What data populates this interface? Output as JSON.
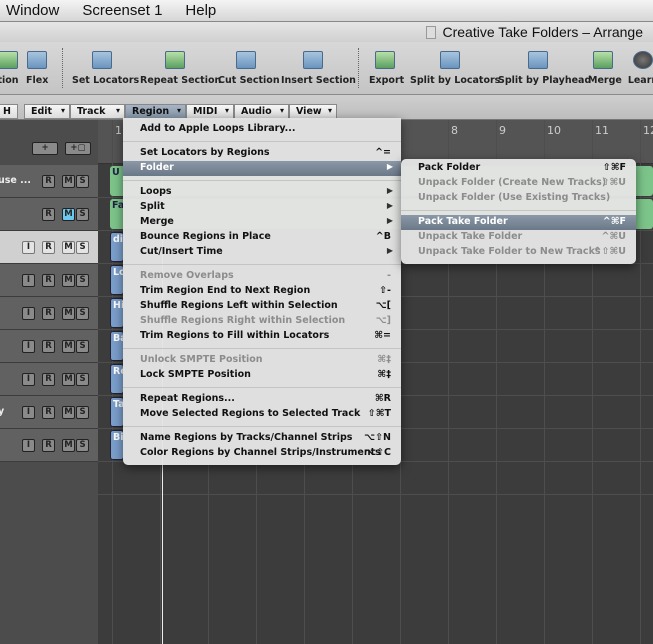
{
  "menubar": [
    "Window",
    "Screenset 1",
    "Help"
  ],
  "window_title": "Creative Take Folders – Arrange",
  "toolbar": {
    "items": [
      {
        "label": "tion",
        "icon": "automation-icon"
      },
      {
        "label": "Flex",
        "icon": "flex-icon"
      },
      {
        "label": "Set Locators",
        "icon": "set-locators-icon"
      },
      {
        "label": "Repeat Section",
        "icon": "repeat-section-icon"
      },
      {
        "label": "Cut Section",
        "icon": "cut-section-icon"
      },
      {
        "label": "Insert Section",
        "icon": "insert-section-icon"
      },
      {
        "label": "Export",
        "icon": "export-icon"
      },
      {
        "label": "Split by Locators",
        "icon": "split-locators-icon"
      },
      {
        "label": "Split by Playhead",
        "icon": "split-playhead-icon"
      },
      {
        "label": "Merge",
        "icon": "merge-icon"
      },
      {
        "label": "Learn",
        "icon": "learn-knob-icon"
      }
    ]
  },
  "local_menu": {
    "left_button": "H",
    "items": [
      "Edit",
      "Track",
      "Region",
      "MIDI",
      "Audio",
      "View"
    ],
    "active": "Region"
  },
  "track_header": {
    "add_label": "+",
    "add_folder_label": "+▢"
  },
  "tracks": [
    {
      "name": "use ...",
      "buttons": [
        "R",
        "M",
        "S"
      ],
      "mute_on": false
    },
    {
      "name": "",
      "buttons": [
        "R",
        "M",
        "S"
      ],
      "mute_on": true
    },
    {
      "name": "",
      "buttons": [
        "I",
        "R",
        "M",
        "S"
      ],
      "selected": true
    },
    {
      "name": "",
      "buttons": [
        "I",
        "R",
        "M",
        "S"
      ]
    },
    {
      "name": "",
      "buttons": [
        "I",
        "R",
        "M",
        "S"
      ]
    },
    {
      "name": "",
      "buttons": [
        "I",
        "R",
        "M",
        "S"
      ]
    },
    {
      "name": "",
      "buttons": [
        "I",
        "R",
        "M",
        "S"
      ]
    },
    {
      "name": "y",
      "buttons": [
        "I",
        "R",
        "M",
        "S"
      ]
    },
    {
      "name": "",
      "buttons": [
        "I",
        "R",
        "M",
        "S"
      ]
    }
  ],
  "ruler": [
    "1",
    "8",
    "9",
    "10",
    "11",
    "12"
  ],
  "regions": [
    {
      "label": "U",
      "color": "#7cc48a"
    },
    {
      "label": "Fa",
      "color": "#7cc48a"
    },
    {
      "label": "di"
    },
    {
      "label": "Lo"
    },
    {
      "label": "Hi"
    },
    {
      "label": "Ba"
    },
    {
      "label": "Re"
    },
    {
      "label": "Ta"
    },
    {
      "label": "Bi"
    }
  ],
  "region_menu": [
    {
      "label": "Add to Apple Loops Library...",
      "shortcut": ""
    },
    {
      "sep": true
    },
    {
      "label": "Set Locators by Regions",
      "shortcut": "^="
    },
    {
      "label": "Folder",
      "submenu": true,
      "highlighted": true
    },
    {
      "sep": true
    },
    {
      "label": "Loops",
      "submenu": true
    },
    {
      "label": "Split",
      "submenu": true
    },
    {
      "label": "Merge",
      "submenu": true
    },
    {
      "label": "Bounce Regions in Place",
      "shortcut": "^B"
    },
    {
      "label": "Cut/Insert Time",
      "submenu": true
    },
    {
      "sep": true
    },
    {
      "label": "Remove Overlaps",
      "shortcut": "-",
      "disabled": true
    },
    {
      "label": "Trim Region End to Next Region",
      "shortcut": "⇧-"
    },
    {
      "label": "Shuffle Regions Left within Selection",
      "shortcut": "⌥["
    },
    {
      "label": "Shuffle Regions Right within Selection",
      "shortcut": "⌥]",
      "disabled": true
    },
    {
      "label": "Trim Regions to Fill within Locators",
      "shortcut": "⌘="
    },
    {
      "sep": true
    },
    {
      "label": "Unlock SMPTE Position",
      "shortcut": "⌘‡",
      "disabled": true
    },
    {
      "label": "Lock SMPTE Position",
      "shortcut": "⌘‡"
    },
    {
      "sep": true
    },
    {
      "label": "Repeat Regions...",
      "shortcut": "⌘R"
    },
    {
      "label": "Move Selected Regions to Selected Track",
      "shortcut": "⇧⌘T"
    },
    {
      "sep": true
    },
    {
      "label": "Name Regions by Tracks/Channel Strips",
      "shortcut": "⌥⇧N"
    },
    {
      "label": "Color Regions by Channel Strips/Instruments",
      "shortcut": "⌥⇧C"
    }
  ],
  "folder_submenu": [
    {
      "label": "Pack Folder",
      "shortcut": "⇧⌘F"
    },
    {
      "label": "Unpack Folder (Create New Tracks)",
      "shortcut": "⇧⌘U",
      "disabled": true
    },
    {
      "label": "Unpack Folder (Use Existing Tracks)",
      "shortcut": "",
      "disabled": true
    },
    {
      "sep": true
    },
    {
      "label": "Pack Take Folder",
      "shortcut": "^⌘F",
      "highlighted": true
    },
    {
      "label": "Unpack Take Folder",
      "shortcut": "^⌘U",
      "disabled": true
    },
    {
      "label": "Unpack Take Folder to New Tracks",
      "shortcut": "^⇧⌘U",
      "disabled": true
    }
  ]
}
